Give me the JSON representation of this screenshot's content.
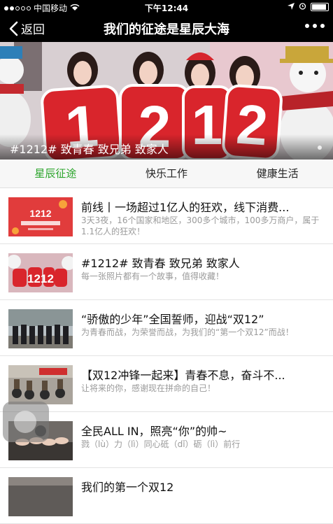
{
  "status_bar": {
    "carrier": "中国移动",
    "time": "下午12:44"
  },
  "nav": {
    "back_label": "返回",
    "title": "我们的征途是星辰大海"
  },
  "banner": {
    "numbers": [
      "1",
      "2",
      "1",
      "2"
    ],
    "caption": "#1212# 致青春 致兄弟 致家人"
  },
  "tabs": [
    "星辰征途",
    "快乐工作",
    "健康生活"
  ],
  "articles": [
    {
      "title": "前线丨一场超过1亿人的狂欢，线下消费...",
      "desc": "3天3夜，16个国家和地区，300多个城市，100多万商户，属于1.1亿人的狂欢！",
      "thumb_text": "1212"
    },
    {
      "title": "#1212# 致青春 致兄弟 致家人",
      "desc": "每一张照片都有一个故事，值得收藏！",
      "thumb_text": "1212"
    },
    {
      "title": "“骄傲的少年”全国誓师，迎战“双12”",
      "desc": "为青春而战，为荣誉而战，为我们的“第一个双12”而战！",
      "thumb_text": ""
    },
    {
      "title": "【双12冲锋一起来】青春不息，奋斗不...",
      "desc": "让将来的你，感谢现在拼命的自己！",
      "thumb_text": ""
    },
    {
      "title": "全民ALL IN，照亮“你”的帅~",
      "desc": "戮（lù）力（lì）同心砥（dǐ）砺（lì）前行",
      "thumb_text": ""
    },
    {
      "title": "我们的第一个双12",
      "desc": "",
      "thumb_text": ""
    }
  ],
  "colors": {
    "active_tab": "#2aa42a",
    "banner_red": "#d9252c"
  }
}
